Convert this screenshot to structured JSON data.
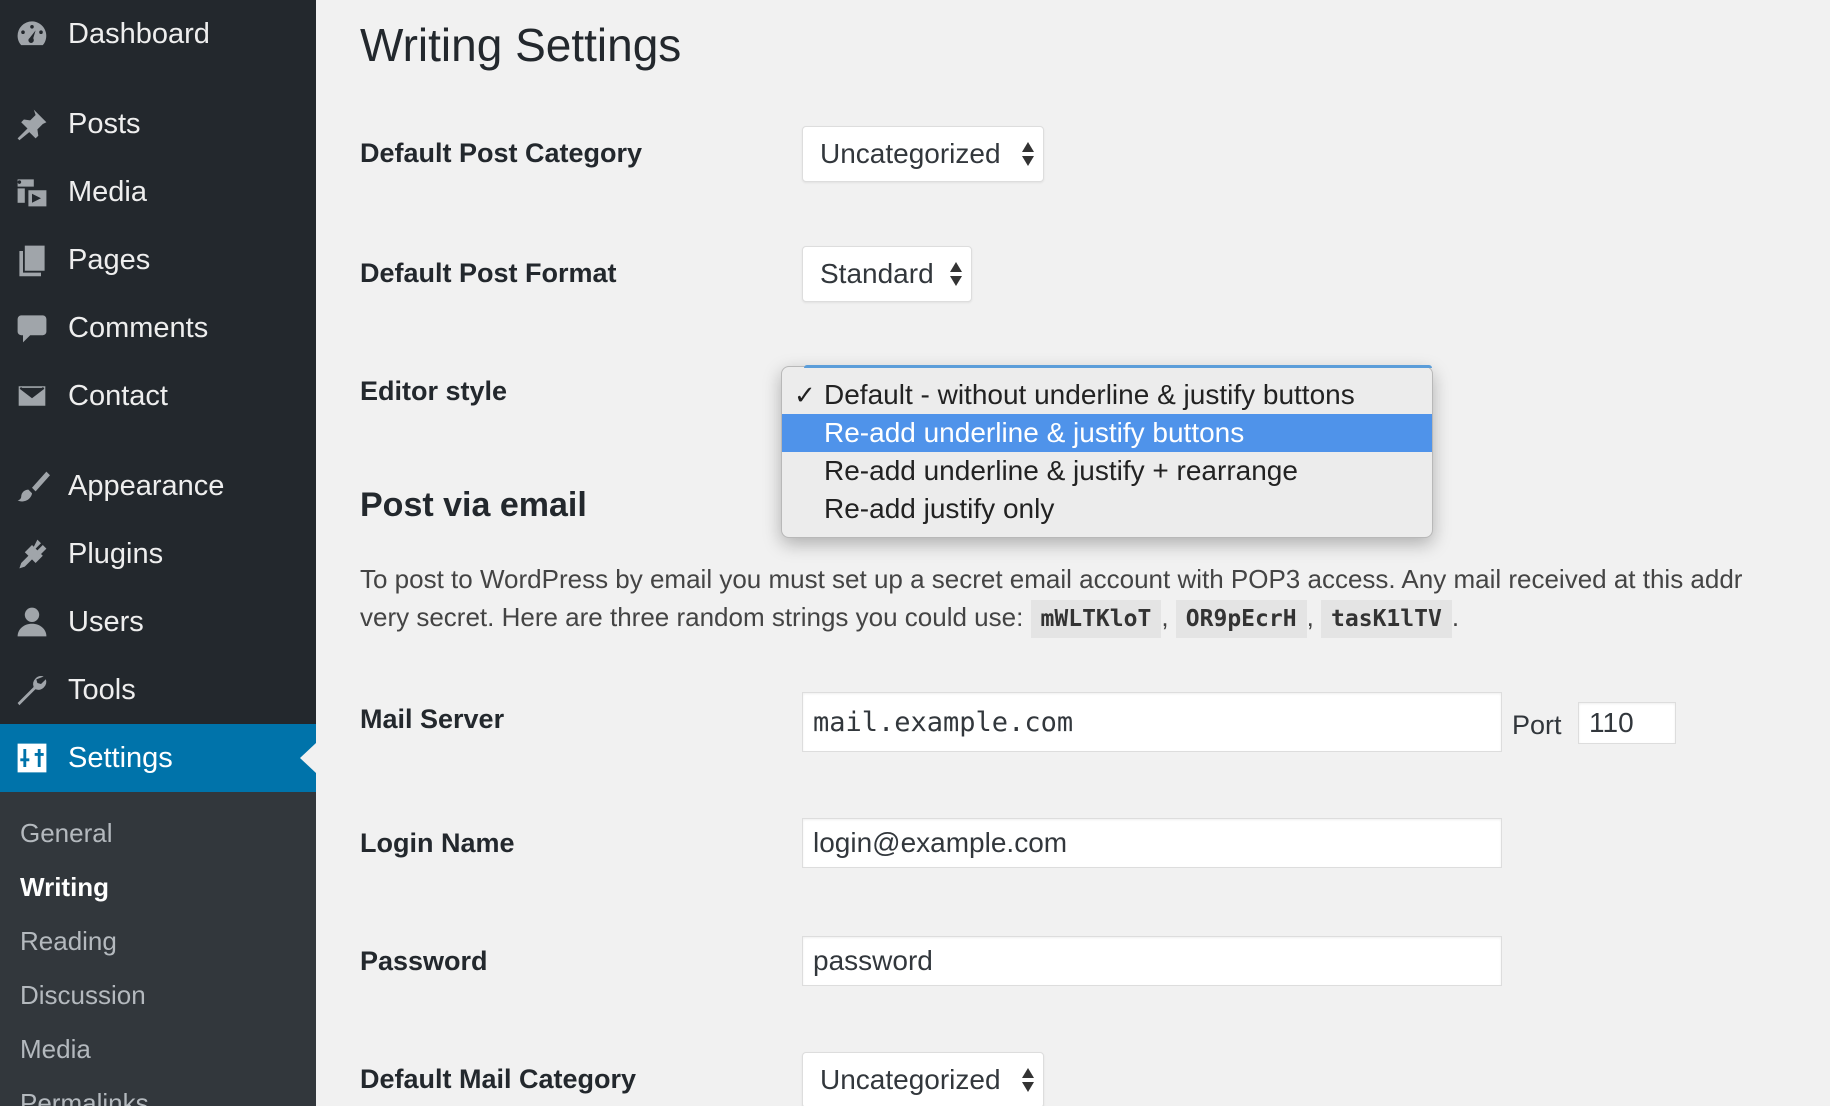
{
  "sidebar": {
    "items": [
      {
        "label": "Dashboard",
        "icon": "dashboard-icon"
      },
      {
        "label": "Posts",
        "icon": "pin-icon"
      },
      {
        "label": "Media",
        "icon": "media-icon"
      },
      {
        "label": "Pages",
        "icon": "pages-icon"
      },
      {
        "label": "Comments",
        "icon": "comment-icon"
      },
      {
        "label": "Contact",
        "icon": "envelope-icon"
      },
      {
        "label": "Appearance",
        "icon": "paintbrush-icon"
      },
      {
        "label": "Plugins",
        "icon": "plugin-icon"
      },
      {
        "label": "Users",
        "icon": "user-icon"
      },
      {
        "label": "Tools",
        "icon": "wrench-icon"
      },
      {
        "label": "Settings",
        "icon": "settings-icon",
        "active": true
      }
    ],
    "submenu": [
      "General",
      "Writing",
      "Reading",
      "Discussion",
      "Media",
      "Permalinks"
    ],
    "current_submenu": "Writing"
  },
  "main": {
    "title": "Writing Settings",
    "default_post_category": {
      "label": "Default Post Category",
      "value": "Uncategorized"
    },
    "default_post_format": {
      "label": "Default Post Format",
      "value": "Standard"
    },
    "editor_style": {
      "label": "Editor style",
      "options": [
        "Default - without underline & justify buttons",
        "Re-add underline & justify buttons",
        "Re-add underline & justify + rearrange",
        "Re-add justify only"
      ],
      "checked_option": "Default - without underline & justify buttons",
      "highlighted_option": "Re-add underline & justify buttons"
    },
    "post_via_email": {
      "title": "Post via email",
      "description_line1": "To post to WordPress by email you must set up a secret email account with POP3 access. Any mail received at this addr",
      "description_line2": "very secret. Here are three random strings you could use:",
      "random_strings": [
        "mWLTKloT",
        "OR9pEcrH",
        "tasK1lTV"
      ],
      "separator": ",",
      "end": "."
    },
    "mail_server": {
      "label": "Mail Server",
      "value": "mail.example.com",
      "port_label": "Port",
      "port_value": "110"
    },
    "login_name": {
      "label": "Login Name",
      "value": "login@example.com"
    },
    "password": {
      "label": "Password",
      "value": "password"
    },
    "default_mail_category": {
      "label": "Default Mail Category",
      "value": "Uncategorized"
    }
  },
  "colors": {
    "sidebar_bg": "#23282d",
    "submenu_bg": "#32373c",
    "active_bg": "#0073aa",
    "highlight": "#4f93ea",
    "page_bg": "#f1f1f1"
  }
}
